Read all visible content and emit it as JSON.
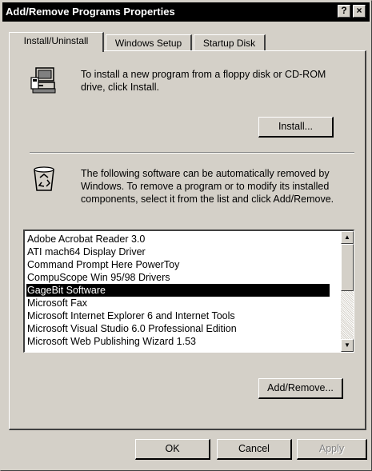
{
  "window": {
    "title": "Add/Remove Programs Properties",
    "help_button": "?",
    "close_button": "×"
  },
  "tabs": [
    {
      "label": "Install/Uninstall",
      "active": true
    },
    {
      "label": "Windows Setup",
      "active": false
    },
    {
      "label": "Startup Disk",
      "active": false
    }
  ],
  "install": {
    "description": "To install a new program from a floppy disk or CD-ROM drive, click Install.",
    "button_label": "Install...",
    "icon": "computer-install-icon"
  },
  "uninstall": {
    "description": "The following software can be automatically removed by Windows. To remove a program or to modify its installed components, select it from the list and click Add/Remove.",
    "icon": "recycle-bin-icon",
    "button_label": "Add/Remove..."
  },
  "programs": {
    "items": [
      "Adobe Acrobat Reader 3.0",
      "ATI mach64 Display Driver",
      "Command Prompt Here PowerToy",
      "CompuScope Win 95/98 Drivers",
      "GageBit Software",
      "Microsoft Fax",
      "Microsoft Internet Explorer 6 and Internet Tools",
      "Microsoft Visual Studio 6.0 Professional Edition",
      "Microsoft Web Publishing Wizard 1.53"
    ],
    "selected": "GageBit Software",
    "scroll_up": "▲",
    "scroll_down": "▼"
  },
  "footer": {
    "ok_label": "OK",
    "cancel_label": "Cancel",
    "apply_label": "Apply",
    "apply_enabled": false
  },
  "colors": {
    "face": "#d4d0c8",
    "titlebar": "#000000",
    "selection": "#000000"
  }
}
